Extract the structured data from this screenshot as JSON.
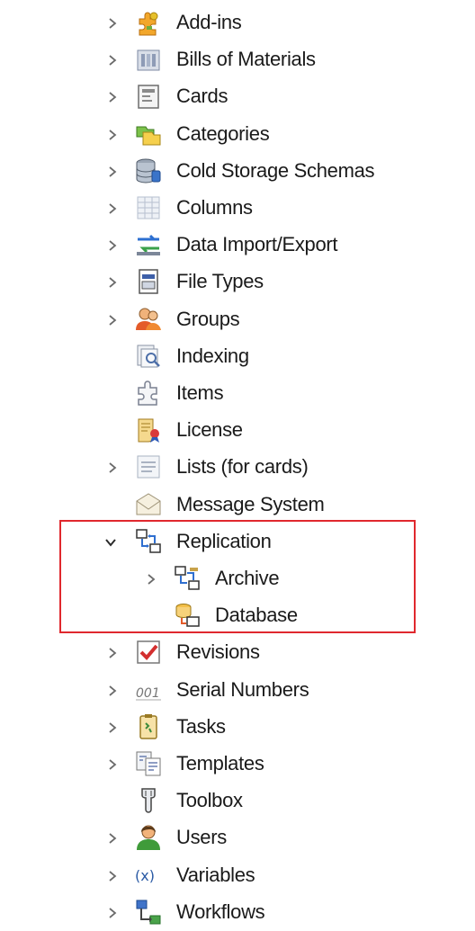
{
  "tree": {
    "items": [
      {
        "id": "add-ins",
        "label": "Add-ins",
        "icon": "puzzle-icon",
        "expandable": true,
        "expanded": false,
        "level": 0
      },
      {
        "id": "bills-of-materials",
        "label": "Bills of Materials",
        "icon": "bill-of-materials-icon",
        "expandable": true,
        "expanded": false,
        "level": 0
      },
      {
        "id": "cards",
        "label": "Cards",
        "icon": "card-icon",
        "expandable": true,
        "expanded": false,
        "level": 0
      },
      {
        "id": "categories",
        "label": "Categories",
        "icon": "categories-icon",
        "expandable": true,
        "expanded": false,
        "level": 0
      },
      {
        "id": "cold-storage-schemas",
        "label": "Cold Storage Schemas",
        "icon": "cold-storage-icon",
        "expandable": true,
        "expanded": false,
        "level": 0
      },
      {
        "id": "columns",
        "label": "Columns",
        "icon": "columns-icon",
        "expandable": true,
        "expanded": false,
        "level": 0
      },
      {
        "id": "data-import-export",
        "label": "Data Import/Export",
        "icon": "import-export-icon",
        "expandable": true,
        "expanded": false,
        "level": 0
      },
      {
        "id": "file-types",
        "label": "File Types",
        "icon": "file-types-icon",
        "expandable": true,
        "expanded": false,
        "level": 0
      },
      {
        "id": "groups",
        "label": "Groups",
        "icon": "groups-icon",
        "expandable": true,
        "expanded": false,
        "level": 0
      },
      {
        "id": "indexing",
        "label": "Indexing",
        "icon": "indexing-icon",
        "expandable": false,
        "expanded": false,
        "level": 0
      },
      {
        "id": "items",
        "label": "Items",
        "icon": "items-icon",
        "expandable": false,
        "expanded": false,
        "level": 0
      },
      {
        "id": "license",
        "label": "License",
        "icon": "license-icon",
        "expandable": false,
        "expanded": false,
        "level": 0
      },
      {
        "id": "lists-for-cards",
        "label": "Lists (for cards)",
        "icon": "lists-icon",
        "expandable": true,
        "expanded": false,
        "level": 0
      },
      {
        "id": "message-system",
        "label": "Message System",
        "icon": "message-icon",
        "expandable": false,
        "expanded": false,
        "level": 0
      },
      {
        "id": "replication",
        "label": "Replication",
        "icon": "replication-icon",
        "expandable": true,
        "expanded": true,
        "level": 0
      },
      {
        "id": "archive",
        "label": "Archive",
        "icon": "archive-icon",
        "expandable": true,
        "expanded": false,
        "level": 1
      },
      {
        "id": "database",
        "label": "Database",
        "icon": "database-icon",
        "expandable": false,
        "expanded": false,
        "level": 1
      },
      {
        "id": "revisions",
        "label": "Revisions",
        "icon": "revisions-icon",
        "expandable": true,
        "expanded": false,
        "level": 0
      },
      {
        "id": "serial-numbers",
        "label": "Serial Numbers",
        "icon": "serial-numbers-icon",
        "expandable": true,
        "expanded": false,
        "level": 0
      },
      {
        "id": "tasks",
        "label": "Tasks",
        "icon": "tasks-icon",
        "expandable": true,
        "expanded": false,
        "level": 0
      },
      {
        "id": "templates",
        "label": "Templates",
        "icon": "templates-icon",
        "expandable": true,
        "expanded": false,
        "level": 0
      },
      {
        "id": "toolbox",
        "label": "Toolbox",
        "icon": "toolbox-icon",
        "expandable": false,
        "expanded": false,
        "level": 0
      },
      {
        "id": "users",
        "label": "Users",
        "icon": "user-icon",
        "expandable": true,
        "expanded": false,
        "level": 0
      },
      {
        "id": "variables",
        "label": "Variables",
        "icon": "variables-icon",
        "expandable": true,
        "expanded": false,
        "level": 0
      },
      {
        "id": "workflows",
        "label": "Workflows",
        "icon": "workflows-icon",
        "expandable": true,
        "expanded": false,
        "level": 0
      }
    ]
  },
  "highlight": {
    "color": "#e0282e",
    "target": "replication"
  },
  "colors": {
    "text": "#1a1a1a",
    "chevron": "#6b6b6b",
    "background": "#ffffff"
  }
}
